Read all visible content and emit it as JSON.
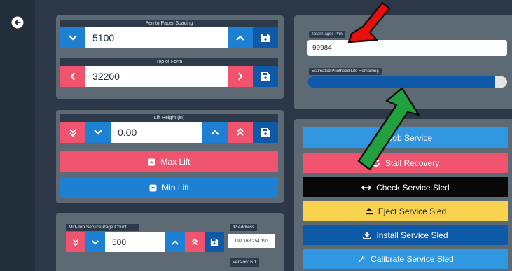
{
  "nav": {
    "back_icon": "arrow-left-circle-icon"
  },
  "pen_spacing": {
    "label": "Pen to Paper Spacing",
    "value": "5100"
  },
  "top_of_form": {
    "label": "Top of Form",
    "value": "32200"
  },
  "lift": {
    "label": "Lift Height (in)",
    "value": "0.00",
    "max_label": "Max Lift",
    "min_label": "Min Lift"
  },
  "mid_job_count": {
    "label": "Mid-Job Service Page Count",
    "value": "500"
  },
  "network": {
    "ip_label": "IP Address",
    "ip_value": "192.168.254.193",
    "version": "Version: 6.1"
  },
  "stats": {
    "total_pages_label": "Total Pages Prin",
    "total_pages_value": "99984",
    "printhead_label": "Estimated Printhead Life Remaining",
    "printhead_life": 0.94
  },
  "service": {
    "mid_job": "id-Job Service",
    "stall_recovery": "Stall Recovery",
    "check_sled": "Check Service Sled",
    "eject_sled": "Eject Service Sled",
    "install_sled": "Install Service Sled",
    "calibrate_sled": "Calibrate Service Sled"
  },
  "colors": {
    "blue": "#1e80d3",
    "navy": "#0f5aa8",
    "red": "#f0536d",
    "black": "#080808",
    "yellow": "#f9d24f",
    "panel": "#5d6a73"
  }
}
